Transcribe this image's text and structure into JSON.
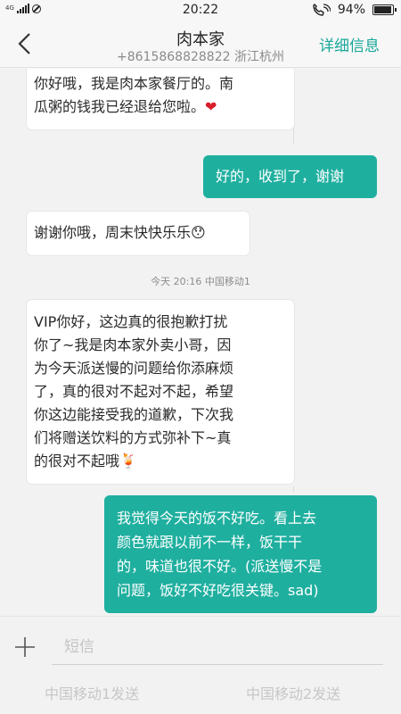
{
  "status_bar": {
    "network": "4G",
    "time": "20:22",
    "battery": "94%"
  },
  "header": {
    "title": "肉本家",
    "subtitle": "+8615868828822  浙江杭州",
    "detail_label": "详细信息"
  },
  "messages": [
    {
      "dir": "in",
      "lines": [
        "你好哦，我是肉本家餐厅的。南",
        "瓜粥的钱我已经退给您啦。"
      ],
      "emoji": "❤"
    },
    {
      "dir": "out",
      "lines": [
        "好的，收到了，谢谢"
      ]
    },
    {
      "dir": "in",
      "lines": [
        "谢谢你哦，周末快快乐乐"
      ],
      "emoji": "😯"
    },
    {
      "dir": "in",
      "lines": [
        "VIP你好，这边真的很抱歉打扰",
        "你了~我是肉本家外卖小哥，因",
        "为今天派送慢的问题给你添麻烦",
        "了，真的很对不起对不起，希望",
        "你这边能接受我的道歉，下次我",
        "们将赠送饮料的方式弥补下~真",
        "的很对不起哦"
      ],
      "emoji": "🍹"
    },
    {
      "dir": "out",
      "lines": [
        "我觉得今天的饭不好吃。看上去",
        "颜色就跟以前不一样，饭干干",
        "的，味道也很不好。(派送慢不是",
        "问题，饭好不好吃很关键。sad)"
      ]
    }
  ],
  "separator": "今天  20:16  中国移动1",
  "input": {
    "placeholder": "短信"
  },
  "send_buttons": [
    "中国移动1发送",
    "中国移动2发送"
  ],
  "colors": {
    "accent": "#19a89a",
    "outgoing_bubble": "#1faf9f",
    "incoming_bubble": "#ffffff"
  }
}
